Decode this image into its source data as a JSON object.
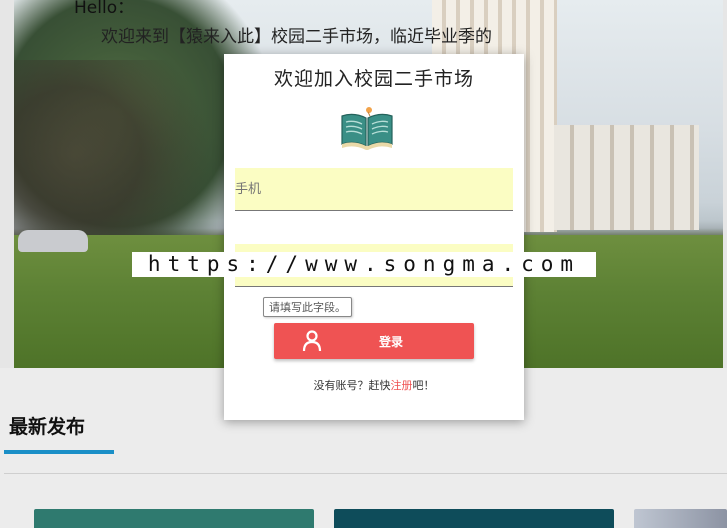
{
  "hero": {
    "hello": "Hello：",
    "welcome_line": "欢迎来到【猿来入此】校园二手市场，临近毕业季的"
  },
  "watermark": "https://www.songma.com",
  "login_modal": {
    "title": "欢迎加入校园二手市场",
    "phone_placeholder": "手机",
    "password_placeholder": "",
    "validation_tooltip": "请填写此字段。",
    "login_button": "登录",
    "register_prefix": "没有账号？赶快",
    "register_link": "注册",
    "register_suffix": "吧！"
  },
  "section": {
    "title": "最新发布"
  },
  "colors": {
    "accent_red": "#ef5353",
    "field_bg": "#fbfdc3",
    "section_blue": "#1a8fc7"
  },
  "icons": [
    "book-icon",
    "user-icon"
  ]
}
